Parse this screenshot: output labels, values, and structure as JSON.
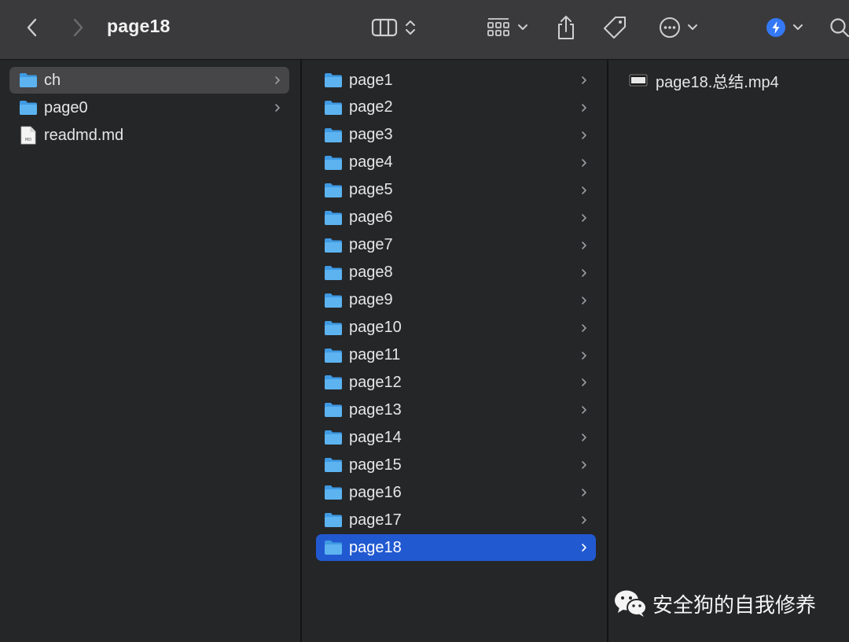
{
  "window": {
    "title": "page18"
  },
  "toolbar": {
    "back_icon": "chevron-left-icon",
    "forward_icon": "chevron-right-icon",
    "view_icon": "columns-view-icon",
    "group_icon": "grid-group-icon",
    "share_icon": "share-icon",
    "tag_icon": "tag-icon",
    "more_icon": "ellipsis-circle-icon",
    "extension_icon": "blue-bolt-icon",
    "search_icon": "search-icon"
  },
  "column1": {
    "items": [
      {
        "label": "ch",
        "kind": "folder",
        "selected": "gray"
      },
      {
        "label": "page0",
        "kind": "folder"
      },
      {
        "label": "readmd.md",
        "kind": "file"
      }
    ]
  },
  "column2": {
    "items": [
      {
        "label": "page1"
      },
      {
        "label": "page2"
      },
      {
        "label": "page3"
      },
      {
        "label": "page4"
      },
      {
        "label": "page5"
      },
      {
        "label": "page6"
      },
      {
        "label": "page7"
      },
      {
        "label": "page8"
      },
      {
        "label": "page9"
      },
      {
        "label": "page10"
      },
      {
        "label": "page11"
      },
      {
        "label": "page12"
      },
      {
        "label": "page13"
      },
      {
        "label": "page14"
      },
      {
        "label": "page15"
      },
      {
        "label": "page16"
      },
      {
        "label": "page17"
      },
      {
        "label": "page18",
        "selected": "blue"
      }
    ]
  },
  "column3": {
    "items": [
      {
        "label": "page18.总结.mp4",
        "kind": "video"
      }
    ]
  },
  "watermark": {
    "text": "安全狗的自我修养",
    "icon": "wechat-icon"
  },
  "colors": {
    "toolbar_bg": "#3a3a3c",
    "pane_bg": "#252628",
    "selection_blue": "#2159d1",
    "selection_gray": "#464649",
    "folder_blue": "#5cb3f0"
  }
}
